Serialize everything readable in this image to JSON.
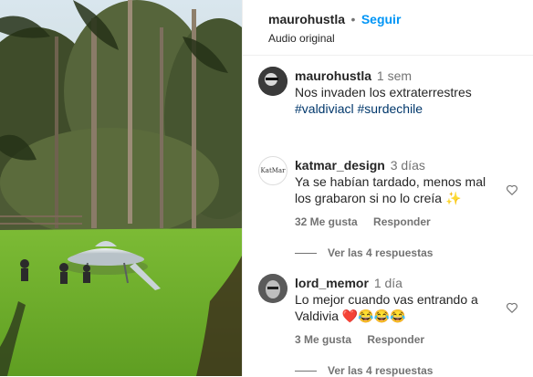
{
  "post": {
    "username": "maurohustla",
    "separator": "•",
    "follow_label": "Seguir",
    "audio_label": "Audio original"
  },
  "caption": {
    "username": "maurohustla",
    "time": "1 sem",
    "text": "Nos invaden los extraterrestres",
    "hashtags": "#valdiviacl #surdechile"
  },
  "comments": [
    {
      "username": "katmar_design",
      "time": "3 días",
      "line1": "Ya se habían tardado, menos mal",
      "line2": "los grabaron si no lo creía",
      "emoji": "✨",
      "likes": "32 Me gusta",
      "reply_label": "Responder",
      "view_replies": "Ver las 4 respuestas",
      "avatar_text": "KatMar"
    },
    {
      "username": "lord_memor",
      "time": "1 día",
      "line1": "Lo mejor cuando vas entrando a",
      "line2": "Valdivia",
      "emoji": "❤️😂😂😂",
      "likes": "3 Me gusta",
      "reply_label": "Responder",
      "view_replies": "Ver las 4 respuestas"
    }
  ],
  "colors": {
    "follow": "#0095f6",
    "muted": "#737373",
    "hashtag": "#00376b",
    "grass": "#6fae2c"
  },
  "icons": [
    "heart-outline-icon",
    "heart-outline-icon"
  ]
}
